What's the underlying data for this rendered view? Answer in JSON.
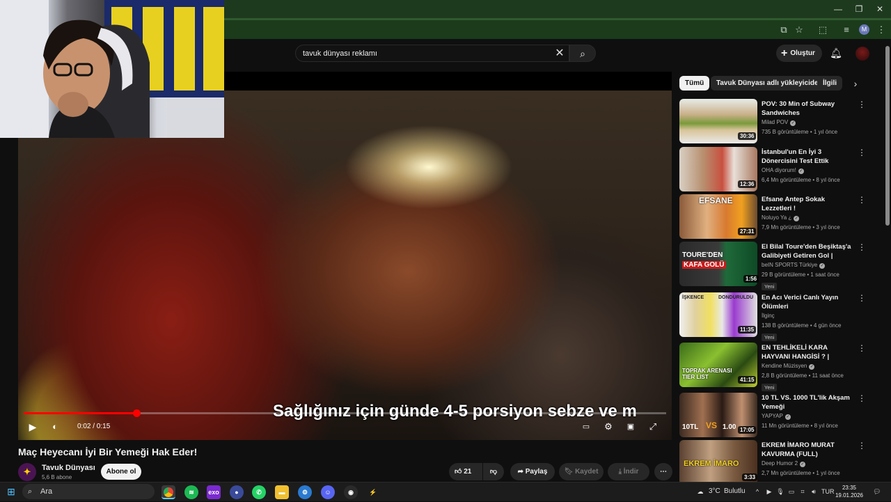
{
  "search": {
    "query": "tavuk dünyası reklamı",
    "placeholder": "Ara"
  },
  "header": {
    "create_label": "Oluştur"
  },
  "browser": {
    "profile_initial": "M"
  },
  "player": {
    "subtitle": "Sağlığınız için günde 4-5 porsiyon sebze ve m",
    "time": "0:02 / 0:15",
    "progress": 0.175
  },
  "video": {
    "title": "Maç Heyecanı İyi Bir Yemeği Hak Eder!",
    "channel": "Tavuk Dünyası",
    "subscribers": "5,6 B abone",
    "subscribe_label": "Abone ol",
    "likes": "21",
    "share_label": "Paylaş",
    "save_label": "Kaydet",
    "download_label": "İndir"
  },
  "chips": [
    "Tümü",
    "Tavuk Dünyası adlı yükleyiciden",
    "İlgili"
  ],
  "recommendations": [
    {
      "title": "POV: 30 Min of Subway Sandwiches",
      "channel": "Milad POV",
      "meta": "735 B görüntüleme • 1 yıl önce",
      "duration": "30:36",
      "badge": ""
    },
    {
      "title": "İstanbul'un En İyi 3 Dönercisini Test Ettik",
      "channel": "OHA diyorum!",
      "meta": "6,4 Mn görüntüleme • 8 yıl önce",
      "duration": "12:36",
      "badge": ""
    },
    {
      "title": "Efsane Antep Sokak Lezzetleri !",
      "channel": "Noluyo Ya ¿",
      "meta": "7,9 Mn görüntüleme • 3 yıl önce",
      "duration": "27:31",
      "badge": ""
    },
    {
      "title": "El Bilal Toure'den Beşiktaş'a Galibiyeti Getiren Gol | Beşikta...",
      "channel": "beIN SPORTS Türkiye",
      "meta": "29 B görüntüleme • 1 saat önce",
      "duration": "1:56",
      "badge": "Yeni"
    },
    {
      "title": "En Acı Verici Canlı Yayın Ölümleri",
      "channel": "İlginç",
      "meta": "138 B görüntüleme • 4 gün önce",
      "duration": "11:35",
      "badge": "Yeni"
    },
    {
      "title": "EN TEHLİKELİ KARA HAYVANI HANGİSİ ? | TOPRAK ARENASI...",
      "channel": "Kendine Müzisyen",
      "meta": "2,8 B görüntüleme • 11 saat önce",
      "duration": "41:15",
      "badge": "Yeni"
    },
    {
      "title": "10 TL VS. 1000 TL'lik Akşam Yemeği",
      "channel": "YAPYAP",
      "meta": "11 Mn görüntüleme • 8 yıl önce",
      "duration": "17:05",
      "badge": ""
    },
    {
      "title": "EKREM İMARO MURAT KAVURMA (FULL)",
      "channel": "Deep Humor 2",
      "meta": "2,7 Mn görüntüleme • 1 yıl önce",
      "duration": "3:33",
      "badge": ""
    }
  ],
  "thumb_text": {
    "t3": "EFSANE",
    "t4a": "TOURE'DEN",
    "t4b": "KAFA GOLÜ",
    "t5a": "İŞKENCE",
    "t5b": "DONDURULDU",
    "t6": "TOPRAK ARENASI TIER LIST",
    "t7a": "10TL",
    "t7b": "VS",
    "t7c": "1.00",
    "t8": "EKREM İMARO"
  },
  "taskbar": {
    "search_label": "Ara",
    "weather": "3°C",
    "weather_desc": "Bulutlu",
    "lang": "TUR",
    "time": "23:35",
    "date": "19.01.2026"
  },
  "colors": {
    "accent": "#ff0000",
    "chrome_frame": "#1e3a1e",
    "background": "#0f0f0f"
  }
}
